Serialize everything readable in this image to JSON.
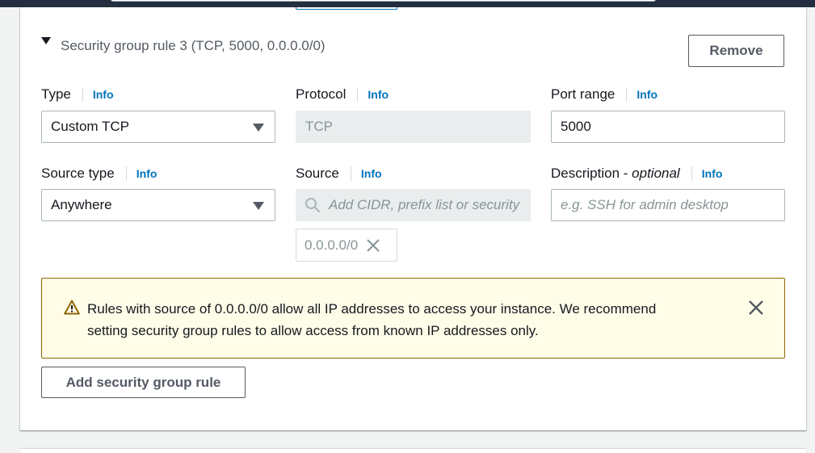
{
  "rule": {
    "title": "Security group rule 3 (TCP, 5000, 0.0.0.0/0)",
    "remove_label": "Remove"
  },
  "fields": {
    "type": {
      "label": "Type",
      "info": "Info",
      "value": "Custom TCP"
    },
    "protocol": {
      "label": "Protocol",
      "info": "Info",
      "value": "TCP"
    },
    "port_range": {
      "label": "Port range",
      "info": "Info",
      "value": "5000"
    },
    "source_type": {
      "label": "Source type",
      "info": "Info",
      "value": "Anywhere"
    },
    "source": {
      "label": "Source",
      "info": "Info",
      "placeholder": "Add CIDR, prefix list or security",
      "token": "0.0.0.0/0"
    },
    "description": {
      "label": "Description",
      "label_suffix": "optional",
      "info": "Info",
      "placeholder": "e.g. SSH for admin desktop"
    }
  },
  "alert": {
    "line1": "Rules with source of 0.0.0.0/0 allow all IP addresses to access your instance. We recommend",
    "line2": "setting security group rules to allow access from known IP addresses only."
  },
  "add_rule_label": "Add security group rule",
  "icons": {
    "caret": "caret-down-icon",
    "dropdown": "chevron-down-icon",
    "search": "search-icon",
    "token_remove": "close-icon",
    "warning": "warning-icon",
    "alert_dismiss": "close-icon"
  },
  "colors": {
    "info_link": "#0073bb",
    "alert_bg": "#fffce8",
    "alert_border": "#8d6605",
    "header_bar": "#232f3e"
  }
}
